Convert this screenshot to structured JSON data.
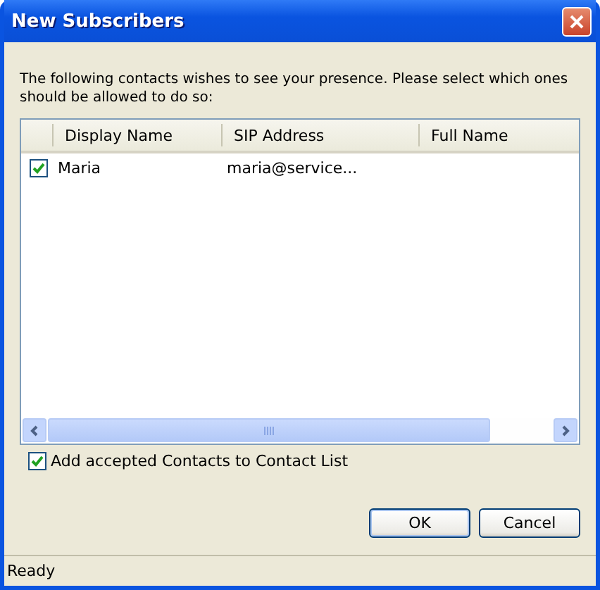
{
  "window": {
    "title": "New Subscribers"
  },
  "message": "The following contacts wishes to see your presence. Please select which ones should be allowed to do so:",
  "table": {
    "columns": [
      "Display Name",
      "SIP Address",
      "Full Name"
    ],
    "rows": [
      {
        "checked": true,
        "display_name": "Maria",
        "sip_address": "maria@service...",
        "full_name": ""
      }
    ]
  },
  "add_to_list": {
    "label": "Add accepted Contacts to Contact List",
    "checked": true
  },
  "buttons": [
    {
      "label": "OK",
      "default": true
    },
    {
      "label": "Cancel",
      "default": false
    }
  ],
  "status_bar": "Ready"
}
